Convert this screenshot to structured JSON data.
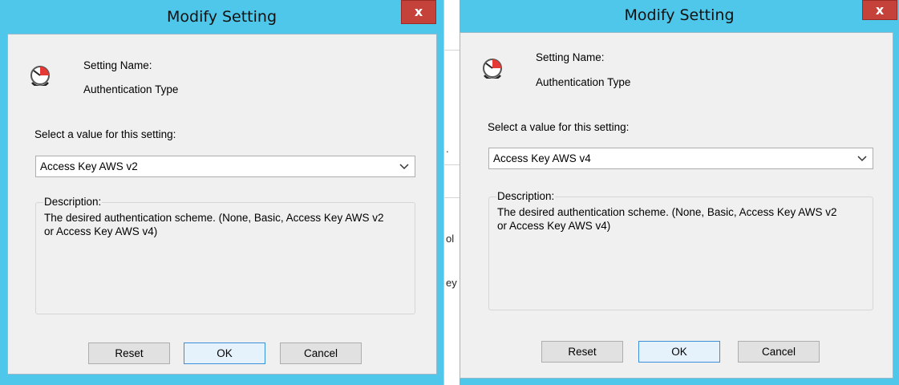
{
  "background": {
    "fragments": [
      ".",
      "ol",
      "ey"
    ]
  },
  "dialogs": [
    {
      "title": "Modify Setting",
      "close_glyph": "x",
      "icon": "clock-icon",
      "setting_name_label": "Setting Name:",
      "setting_name_value": "Authentication Type",
      "select_prompt": "Select a value for this setting:",
      "selected_value": "Access Key AWS v2",
      "description_legend": "Description:",
      "description_text": "The desired authentication scheme. (None, Basic, Access Key AWS v2 or Access Key AWS v4)",
      "buttons": {
        "reset": "Reset",
        "ok": "OK",
        "cancel": "Cancel"
      }
    },
    {
      "title": "Modify Setting",
      "close_glyph": "x",
      "icon": "clock-icon",
      "setting_name_label": "Setting Name:",
      "setting_name_value": "Authentication Type",
      "select_prompt": "Select a value for this setting:",
      "selected_value": "Access Key AWS v4",
      "description_legend": "Description:",
      "description_text": "The desired authentication scheme. (None, Basic, Access Key AWS v2 or Access Key AWS v4)",
      "buttons": {
        "reset": "Reset",
        "ok": "OK",
        "cancel": "Cancel"
      }
    }
  ],
  "colors": {
    "title_bar": "#4fc7ea",
    "close_button": "#c5423a",
    "client_area": "#f0f0f0",
    "icon_accent": "#e53935"
  }
}
